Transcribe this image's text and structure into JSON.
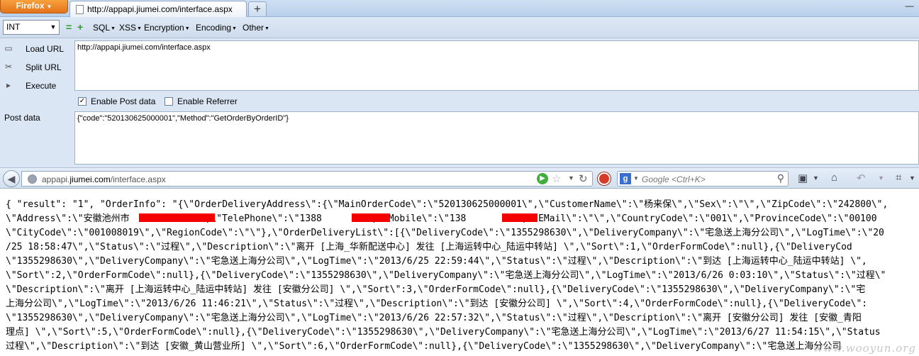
{
  "browser": {
    "app_button": "Firefox",
    "tab_title": "http://appapi.jiumei.com/interface.aspx",
    "new_tab": "+",
    "minimize": "—"
  },
  "hackbar": {
    "type_select": "INT",
    "minus": "=",
    "plus": "+",
    "menus": [
      "SQL",
      "XSS",
      "Encryption",
      "Encoding",
      "Other"
    ],
    "load_url": "Load URL",
    "split_url": "Split URL",
    "execute": "Execute",
    "url_value": "http://appapi.jiumei.com/interface.aspx",
    "enable_post": "Enable Post data",
    "enable_referrer": "Enable Referrer",
    "post_label": "Post data",
    "post_value": "{\"code\":\"520130625000001\",\"Method\":\"GetOrderByOrderID\"}",
    "enable_post_checked": true,
    "enable_referrer_checked": false
  },
  "navbar": {
    "host_prefix": "appapi.",
    "host_domain": "jiumei.com",
    "host_path": "/interface.aspx",
    "search_engine": "g",
    "search_placeholder": "Google <Ctrl+K>"
  },
  "content": {
    "lines": [
      "{ \"result\": \"1\", \"OrderInfo\": \"{\\\"OrderDeliveryAddress\\\":{\\\"MainOrderCode\\\":\\\"520130625000001\\\",\\\"CustomerName\\\":\\\"杨来保\\\",\\\"Sex\\\":\\\"\\\",\\\"ZipCode\\\":\\\"242800\\\",",
      "\\\"Address\\\":\\\"安徽池州市          小\\\",\\\"TelePhone\\\":\\\"1388       \\\",\\\"Mobile\\\":\\\"138       4\\\",\\\"EMail\\\":\\\"\\\",\\\"CountryCode\\\":\\\"001\\\",\\\"ProvinceCode\\\":\\\"00100",
      "\\\"CityCode\\\":\\\"001008019\\\",\\\"RegionCode\\\":\\\"\\\"},\\\"OrderDeliveryList\\\":[{\\\"DeliveryCode\\\":\\\"1355298630\\\",\\\"DeliveryCompany\\\":\\\"宅急送上海分公司\\\",\\\"LogTime\\\":\\\"20",
      "/25 18:58:47\\\",\\\"Status\\\":\\\"过程\\\",\\\"Description\\\":\\\"离开 [上海_华新配送中心] 发往 [上海运转中心_陆运中转站] \\\",\\\"Sort\\\":1,\\\"OrderFormCode\\\":null},{\\\"DeliveryCod",
      "\\\"1355298630\\\",\\\"DeliveryCompany\\\":\\\"宅急送上海分公司\\\",\\\"LogTime\\\":\\\"2013/6/25 22:59:44\\\",\\\"Status\\\":\\\"过程\\\",\\\"Description\\\":\\\"到达 [上海运转中心_陆运中转站] \\\",",
      "\\\"Sort\\\":2,\\\"OrderFormCode\\\":null},{\\\"DeliveryCode\\\":\\\"1355298630\\\",\\\"DeliveryCompany\\\":\\\"宅急送上海分公司\\\",\\\"LogTime\\\":\\\"2013/6/26 0:03:10\\\",\\\"Status\\\":\\\"过程\\\"",
      "\\\"Description\\\":\\\"离开 [上海运转中心_陆运中转站] 发往 [安徽分公司] \\\",\\\"Sort\\\":3,\\\"OrderFormCode\\\":null},{\\\"DeliveryCode\\\":\\\"1355298630\\\",\\\"DeliveryCompany\\\":\\\"宅",
      "上海分公司\\\",\\\"LogTime\\\":\\\"2013/6/26 11:46:21\\\",\\\"Status\\\":\\\"过程\\\",\\\"Description\\\":\\\"到达 [安徽分公司] \\\",\\\"Sort\\\":4,\\\"OrderFormCode\\\":null},{\\\"DeliveryCode\\\":",
      "\\\"1355298630\\\",\\\"DeliveryCompany\\\":\\\"宅急送上海分公司\\\",\\\"LogTime\\\":\\\"2013/6/26 22:57:32\\\",\\\"Status\\\":\\\"过程\\\",\\\"Description\\\":\\\"离开 [安徽分公司] 发往 [安徽_青阳",
      "理点] \\\",\\\"Sort\\\":5,\\\"OrderFormCode\\\":null},{\\\"DeliveryCode\\\":\\\"1355298630\\\",\\\"DeliveryCompany\\\":\\\"宅急送上海分公司\\\",\\\"LogTime\\\":\\\"2013/6/27 11:54:15\\\",\\\"Status",
      "过程\\\",\\\"Description\\\":\\\"到达 [安徽_黄山营业所] \\\",\\\"Sort\\\":6,\\\"OrderFormCode\\\":null},{\\\"DeliveryCode\\\":\\\"1355298630\\\",\\\"DeliveryCompany\\\":\\\"宅急送上海分公司"
    ],
    "watermark": "www.wooyun.org"
  },
  "colors": {
    "redaction": "#f40000",
    "accent": "#e3731a"
  }
}
